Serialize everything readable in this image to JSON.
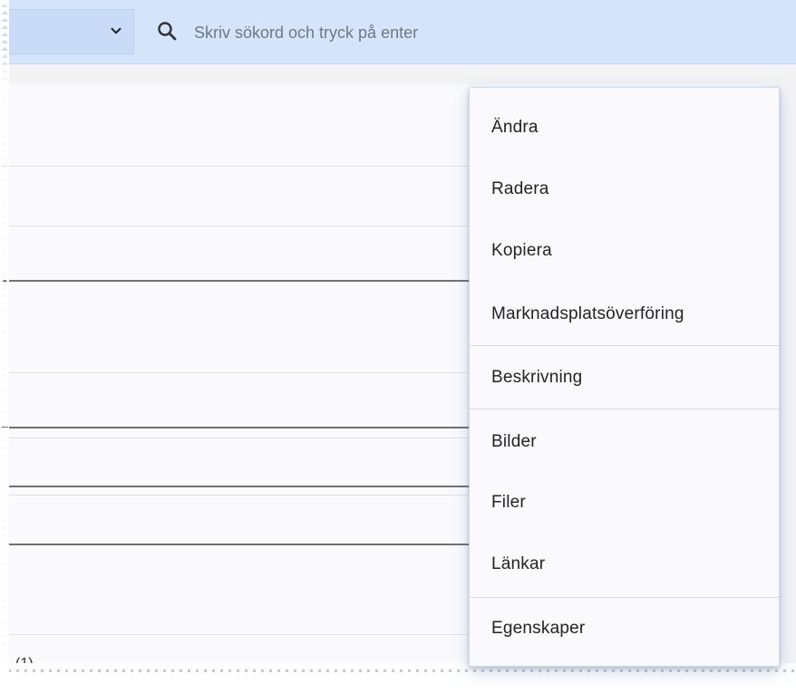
{
  "search": {
    "placeholder": "Skriv sökord och tryck på enter"
  },
  "list": {
    "count_label": "(1)"
  },
  "context_menu": {
    "groups": [
      [
        "Ändra",
        "Radera",
        "Kopiera",
        "Marknadsplatsöverföring"
      ],
      [
        "Beskrivning"
      ],
      [
        "Bilder",
        "Filer",
        "Länkar"
      ],
      [
        "Egenskaper"
      ]
    ]
  },
  "icons": {
    "dropdown": "chevron-down-icon",
    "search": "search-icon"
  },
  "colors": {
    "toolbar_bg": "#d4e4fb",
    "menu_bg": "#fafafd",
    "text": "#222228"
  }
}
